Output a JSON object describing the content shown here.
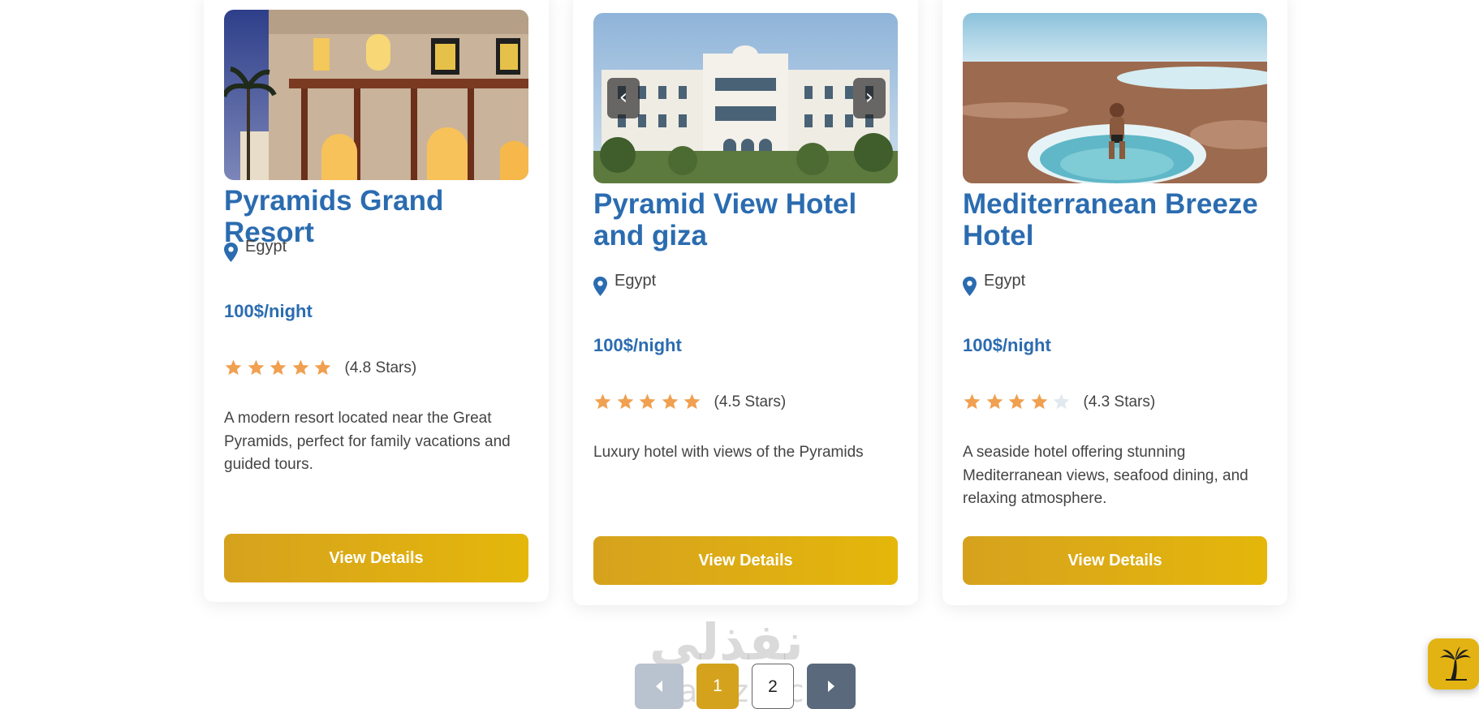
{
  "hotels": [
    {
      "title": "Pyramids Grand Resort",
      "location": "Egypt",
      "price": "100$/night",
      "rating": 4.8,
      "rating_text": "(4.8 Stars)",
      "description": "A modern resort located near the Great Pyramids, perfect for family vacations and guided tours.",
      "button_label": "View Details"
    },
    {
      "title": "Pyramid View Hotel and giza",
      "location": "Egypt",
      "price": "100$/night",
      "rating": 4.5,
      "rating_text": "(4.5 Stars)",
      "description": "Luxury hotel with views of the Pyramids",
      "button_label": "View Details",
      "carousel": {
        "prev_label": "‹",
        "next_label": "›"
      }
    },
    {
      "title": "Mediterranean Breeze Hotel",
      "location": "Egypt",
      "price": "100$/night",
      "rating": 4.3,
      "rating_text": "(4.3 Stars)",
      "description": "A seaside hotel offering stunning Mediterranean views, seafood dining, and relaxing atmosphere.",
      "button_label": "View Details"
    }
  ],
  "pagination": {
    "prev_icon": "caret-left-icon",
    "pages": [
      "1",
      "2"
    ],
    "active_page": "1",
    "next_icon": "caret-right-icon"
  },
  "watermark": {
    "arabic": "نفذلي",
    "latin": "nafezly.com"
  },
  "floating_button_icon": "palm-tree-icon",
  "colors": {
    "accent": "#2b6cb0",
    "gold": "#d4a21c",
    "star_filled": "#f0a050",
    "star_empty": "#e2e8f0"
  }
}
